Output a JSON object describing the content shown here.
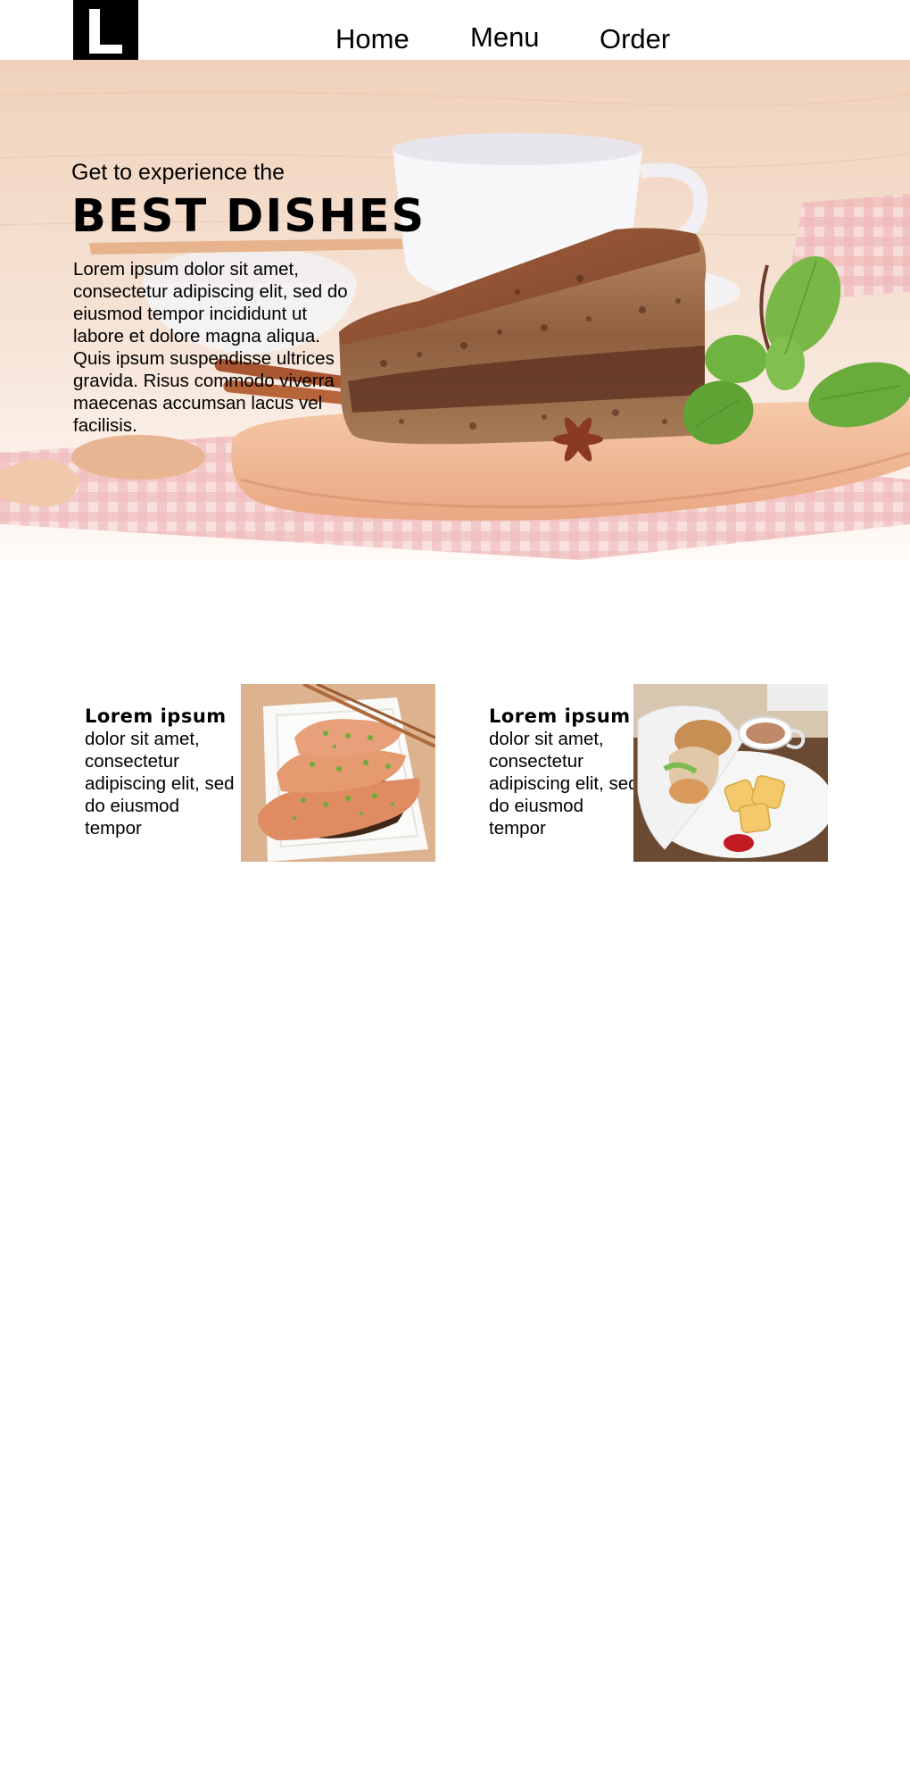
{
  "header": {
    "logo_name": "logo-icon",
    "nav": [
      {
        "label": "Home"
      },
      {
        "label": "Menu"
      },
      {
        "label": "Order"
      }
    ]
  },
  "hero": {
    "tagline": "Get to experience the",
    "title": "BEST DISHES",
    "body": "Lorem ipsum dolor sit amet, consectetur adipiscing elit, sed do eiusmod tempor incididunt ut labore et dolore magna aliqua. Quis ipsum suspendisse ultrices gravida. Risus commodo viverra maecenas accumsan lacus vel facilisis."
  },
  "cards": [
    {
      "title": "Lorem ipsum",
      "text": "dolor sit amet, consectetur adipiscing elit, sed do eiusmod tempor",
      "image": "salmon-dish-photo"
    },
    {
      "title": "Lorem ipsum",
      "text": "dolor sit amet, consectetur adipiscing elit, sed do eiusmod tempor",
      "image": "burger-plate-photo"
    }
  ],
  "colors": {
    "text": "#000000",
    "background": "#ffffff",
    "wood": "#f3d6c1",
    "cake": "#8b5a3c",
    "mint": "#5fa63a",
    "cloth": "#e9a0a4"
  }
}
